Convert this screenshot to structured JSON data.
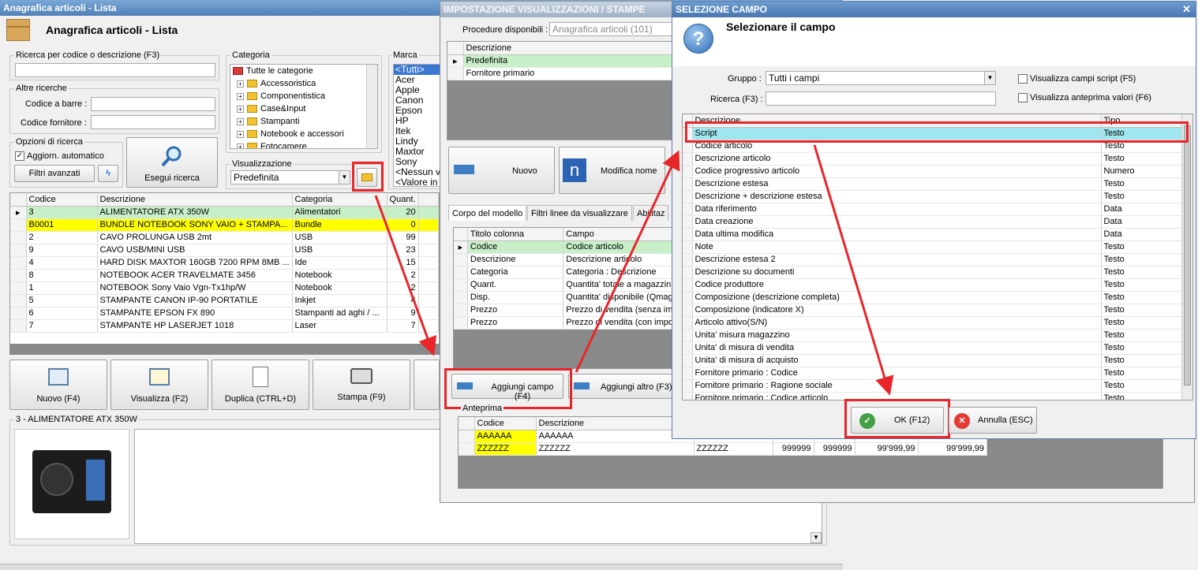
{
  "main": {
    "title": "Anagrafica articoli  - Lista",
    "header": "Anagrafica articoli  - Lista",
    "search": {
      "label": "Ricerca per codice o descrizione (F3)",
      "value": ""
    },
    "other": {
      "label": "Altre ricerche",
      "barcode_label": "Codice a barre :",
      "supplier_label": "Codice fornitore :"
    },
    "options": {
      "label": "Opzioni di ricerca",
      "auto_label": "Aggiorn. automatico",
      "auto_checked": true,
      "advanced_label": "Filtri avanzati",
      "search_btn": "Esegui ricerca"
    },
    "category": {
      "label": "Categoria",
      "items": [
        "Tutte le categorie",
        "Accessoristica",
        "Componentistica",
        "Case&Input",
        "Stampanti",
        "Notebook e accessori",
        "Fotocamere"
      ]
    },
    "brand": {
      "label": "Marca",
      "items": [
        "<Tutti>",
        "Acer",
        "Apple",
        "Canon",
        "Epson",
        "HP",
        "Itek",
        "Lindy",
        "Maxtor",
        "Sony",
        "<Nessun v",
        "<Valore in"
      ]
    },
    "view": {
      "label": "Visualizzazione",
      "value": "Predefinita"
    },
    "table": {
      "headers": [
        "Codice",
        "Descrizione",
        "Categoria",
        "Quant."
      ],
      "rows": [
        [
          "3",
          "ALIMENTATORE ATX 350W",
          "Alimentatori",
          "20"
        ],
        [
          "B0001",
          "BUNDLE NOTEBOOK SONY VAIO + STAMPA...",
          "Bundle",
          "0"
        ],
        [
          "2",
          "CAVO PROLUNGA USB 2mt",
          "USB",
          "99"
        ],
        [
          "9",
          "CAVO USB/MINI USB",
          "USB",
          "23"
        ],
        [
          "4",
          "HARD DISK MAXTOR 160GB 7200 RPM 8MB ...",
          "Ide",
          "15"
        ],
        [
          "8",
          "NOTEBOOK ACER TRAVELMATE 3456",
          "Notebook",
          "2"
        ],
        [
          "1",
          "NOTEBOOK Sony Vaio Vgn-Tx1hp/W",
          "Notebook",
          "2"
        ],
        [
          "5",
          "STAMPANTE CANON IP-90 PORTATILE",
          "Inkjet",
          "4"
        ],
        [
          "6",
          "STAMPANTE EPSON FX 890",
          "Stampanti ad aghi / ...",
          "9"
        ],
        [
          "7",
          "STAMPANTE HP LASERJET 1018",
          "Laser",
          "7"
        ]
      ]
    },
    "toolbar": {
      "new": "Nuovo (F4)",
      "view": "Visualizza (F2)",
      "dup": "Duplica (CTRL+D)",
      "print": "Stampa (F9)"
    },
    "detail_label": "3 - ALIMENTATORE ATX 350W"
  },
  "impostazione": {
    "title": "IMPOSTAZIONE VISUALIZZAZIONI / STAMPE",
    "proc_label": "Procedure disponibili :",
    "proc_value": "Anagrafica articoli (101)",
    "list_header": "Descrizione",
    "list_rows": [
      "Predefinita",
      "Fornitore primario"
    ],
    "new_label": "Nuovo",
    "rename_label": "Modifica nome",
    "tabs": [
      "Corpo del modello",
      "Filtri linee da visualizzare",
      "Abilitaz"
    ],
    "cols_headers": [
      "Titolo colonna",
      "Campo"
    ],
    "cols_rows": [
      [
        "Codice",
        "Codice articolo"
      ],
      [
        "Descrizione",
        "Descrizione articolo"
      ],
      [
        "Categoria",
        "Categoria : Descrizione"
      ],
      [
        "Quant.",
        "Quantita' totale a magazzin"
      ],
      [
        "Disp.",
        "Quantita' disponibile (Qmag"
      ],
      [
        "Prezzo",
        "Prezzo di vendita (senza im"
      ],
      [
        "Prezzo",
        "Prezzo di vendita (con impo"
      ]
    ],
    "add_field": "Aggiungi campo (F4)",
    "add_other": "Aggiungi altro (F3)",
    "preview_label": "Anteprima",
    "preview_headers": [
      "Codice",
      "Descrizione"
    ],
    "preview_rows": [
      [
        "AAAAAA",
        "AAAAAA",
        "",
        "",
        "",
        "",
        ""
      ],
      [
        "ZZZZZZ",
        "ZZZZZZ",
        "ZZZZZZ",
        "999999",
        "999999",
        "99'999,99",
        "99'999,99"
      ]
    ]
  },
  "selezione": {
    "title": "SELEZIONE CAMPO",
    "heading": "Selezionare il campo",
    "group_label": "Gruppo :",
    "group_value": "Tutti i campi",
    "search_label": "Ricerca (F3) :",
    "search_value": "",
    "chk_scripts": "Visualizza campi script (F5)",
    "chk_preview": "Visualizza anteprima valori (F6)",
    "headers": [
      "Descrizione",
      "Tipo"
    ],
    "rows": [
      [
        "Script",
        "Testo"
      ],
      [
        "Codice articolo",
        "Testo"
      ],
      [
        "Descrizione articolo",
        "Testo"
      ],
      [
        "Codice progressivo articolo",
        "Numero"
      ],
      [
        "Descrizione estesa",
        "Testo"
      ],
      [
        "Descrizione + descrizione estesa",
        "Testo"
      ],
      [
        "Data riferimento",
        "Data"
      ],
      [
        "Data creazione",
        "Data"
      ],
      [
        "Data ultima modifica",
        "Data"
      ],
      [
        "Note",
        "Testo"
      ],
      [
        "Descrizione estesa 2",
        "Testo"
      ],
      [
        "Descrizione su documenti",
        "Testo"
      ],
      [
        "Codice produttore",
        "Testo"
      ],
      [
        "Composizione (descrizione completa)",
        "Testo"
      ],
      [
        "Composizione (indicatore X)",
        "Testo"
      ],
      [
        "Articolo attivo(S/N)",
        "Testo"
      ],
      [
        "Unita' misura magazzino",
        "Testo"
      ],
      [
        "Unita' di misura di vendita",
        "Testo"
      ],
      [
        "Unita' di misura di acquisto",
        "Testo"
      ],
      [
        "Fornitore primario : Codice",
        "Testo"
      ],
      [
        "Fornitore primario : Ragione sociale",
        "Testo"
      ],
      [
        "Fornitore primario : Codice articolo",
        "Testo"
      ]
    ],
    "ok_label": "OK (F12)",
    "cancel_label": "Annulla (ESC)"
  },
  "colors": {
    "accent_red": "#e8262a",
    "highlight_green": "#c8f0c8",
    "highlight_yellow": "#ffff00",
    "selected_cyan": "#9fe6ee"
  }
}
